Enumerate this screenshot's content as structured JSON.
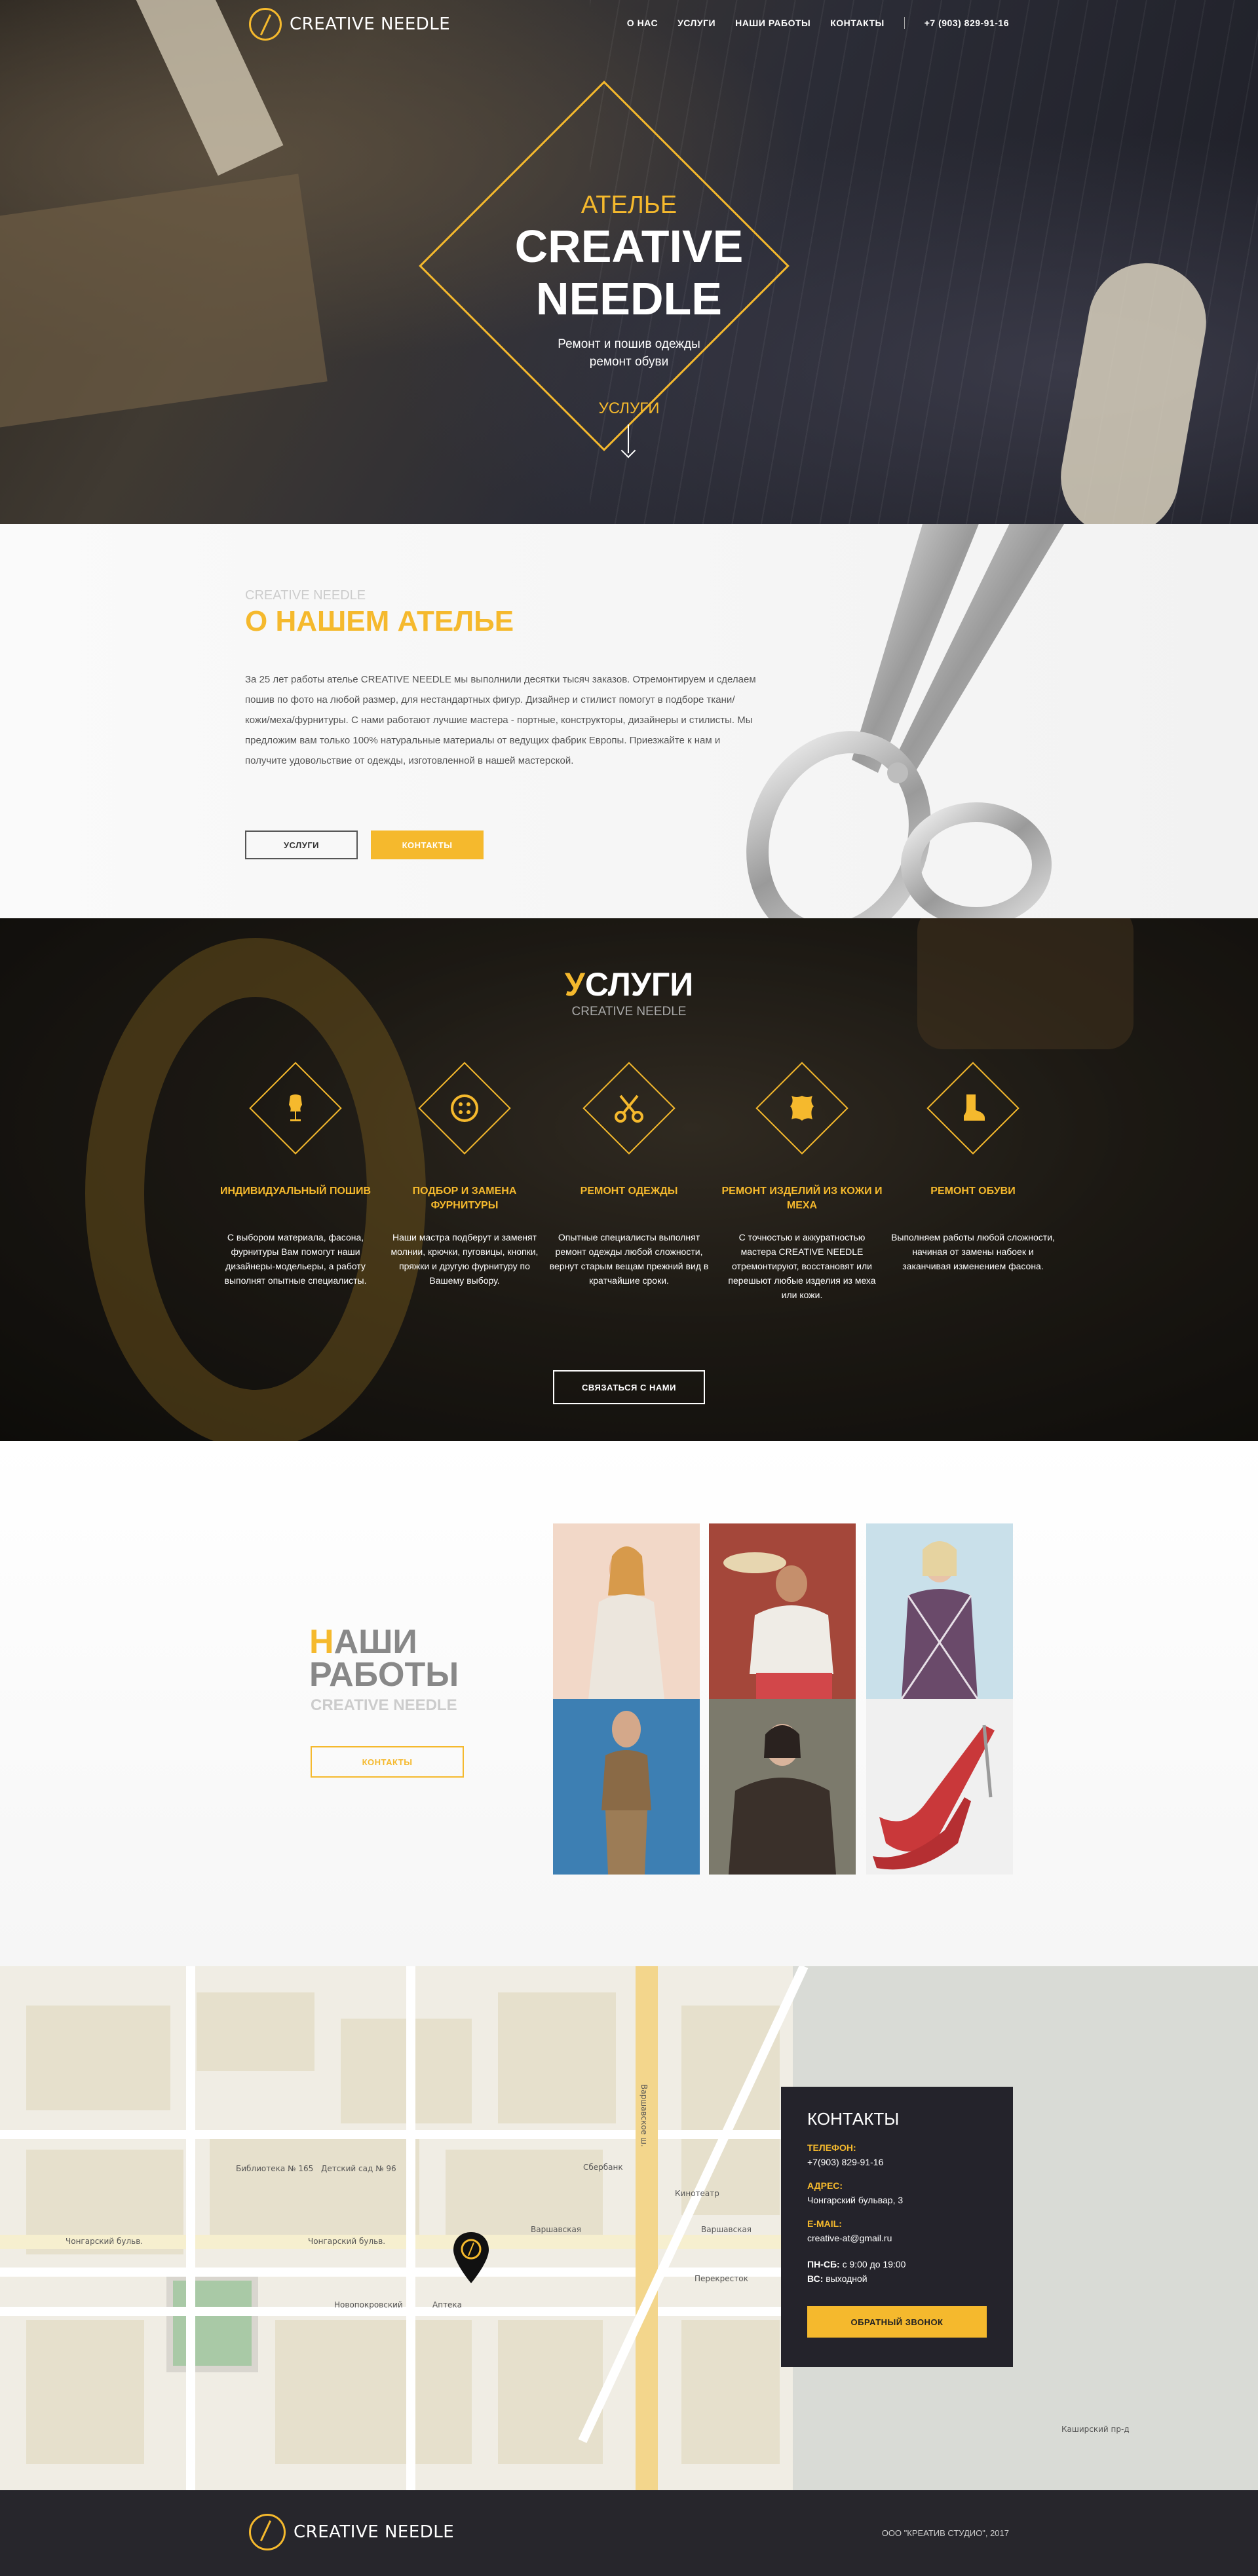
{
  "brand": {
    "name": "CREATIVE NEEDLE",
    "accent": "#f5b92d"
  },
  "nav": {
    "items": [
      "О НАС",
      "УСЛУГИ",
      "НАШИ РАБОТЫ",
      "КОНТАКТЫ"
    ],
    "phone": "+7 (903) 829-91-16"
  },
  "hero": {
    "kicker": "АТЕЛЬЕ",
    "title_line1": "CREATIVE",
    "title_line2": "NEEDLE",
    "subtitle_line1": "Ремонт и пошив одежды",
    "subtitle_line2": "ремонт обуви",
    "cta": "УСЛУГИ"
  },
  "about": {
    "sub": "CREATIVE NEEDLE",
    "title": "О НАШЕМ АТЕЛЬЕ",
    "text": "За 25 лет работы ателье CREATIVE NEEDLE мы выполнили десятки тысяч заказов. Отремонтируем и сделаем пошив по фото на любой размер, для нестандартных фигур. Дизайнер и стилист помогут в подборе ткани/кожи/меха/фурнитуры. С нами работают лучшие мастера - портные, конструкторы, дизайнеры и стилисты. Мы предложим вам только 100% натуральные материалы от ведущих фабрик Европы. Приезжайте к нам и получите удовольствие от одежды, изготовленной в нашей мастерской.",
    "btn_services": "УСЛУГИ",
    "btn_contacts": "КОНТАКТЫ"
  },
  "services": {
    "title_first": "У",
    "title_rest": "СЛУГИ",
    "sub": "CREATIVE NEEDLE",
    "items": [
      {
        "icon": "mannequin-icon",
        "title": "ИНДИВИДУАЛЬНЫЙ ПОШИВ",
        "desc": "С выбором материала, фасона, фурнитуры Вам помогут наши дизайнеры-модельеры, а работу выполнят опытные специалисты."
      },
      {
        "icon": "button-icon",
        "title": "ПОДБОР И ЗАМЕНА ФУРНИТУРЫ",
        "desc": "Наши мастра подберут и заменят молнии, крючки, пуговицы, кнопки, пряжки и другую фурнитуру по Вашему выбору."
      },
      {
        "icon": "scissors-icon",
        "title": "РЕМОНТ ОДЕЖДЫ",
        "desc": "Опытные специалисты выполнят ремонт одежды любой сложности, вернут старым вещам прежний вид в кратчайшие сроки."
      },
      {
        "icon": "leather-icon",
        "title": "РЕМОНТ ИЗДЕЛИЙ ИЗ КОЖИ И МЕХА",
        "desc": "С точностью и аккуратностью мастера CREATIVE NEEDLE отремонтируют, восстановят или перешьют любые изделия из меха или кожи."
      },
      {
        "icon": "boot-icon",
        "title": "РЕМОНТ ОБУВИ",
        "desc": "Выполняем работы любой сложности, начиная от замены набоек и заканчивая изменением фасона."
      }
    ],
    "cta": "СВЯЗАТЬСЯ С НАМИ"
  },
  "works": {
    "title_first": "Н",
    "title_line1_rest": "АШИ",
    "title_line2": "РАБОТЫ",
    "sub": "CREATIVE NEEDLE",
    "btn": "КОНТАКТЫ",
    "photos": [
      {
        "name": "work-photo-white-dress",
        "bg": "#f2d8c8",
        "fg": "#ece6dd"
      },
      {
        "name": "work-photo-man-hat",
        "bg": "#a4473a",
        "fg": "#efece6"
      },
      {
        "name": "work-photo-checked-coat",
        "bg": "#c9e0ea",
        "fg": "#6a4a6a"
      },
      {
        "name": "work-photo-khaki-suit",
        "bg": "#3d7fb3",
        "fg": "#8a6a46"
      },
      {
        "name": "work-photo-fur-coat",
        "bg": "#7c7a6c",
        "fg": "#3a302a"
      },
      {
        "name": "work-photo-red-shoes",
        "bg": "#f0f0f0",
        "fg": "#c9383a"
      }
    ]
  },
  "map": {
    "labels": [
      "Чонгарский бульв.",
      "Чонгарский бульв.",
      "Варшавское ш.",
      "Варшавская",
      "Варшавская",
      "Сбербанк",
      "Кинотеатр",
      "Библиотека № 165",
      "Детский сад № 96",
      "Новопокровский",
      "Аптека",
      "Перекресток",
      "Каширский пр-д"
    ]
  },
  "contacts": {
    "title": "КОНТАКТЫ",
    "phone_label": "ТЕЛЕФОН:",
    "phone": "+7(903) 829-91-16",
    "address_label": "АДРЕС:",
    "address": "Чонгарский бульвар, 3",
    "email_label": "E-MAIL:",
    "email": "creative-at@gmail.ru",
    "hours_label": "ПН-СБ:",
    "hours": "с 9:00 до 19:00",
    "sunday_label": "ВС:",
    "sunday": "выходной",
    "btn": "ОБРАТНЫЙ ЗВОНОК"
  },
  "footer": {
    "brand": "CREATIVE NEEDLE",
    "copyright": "ООО \"КРЕАТИВ СТУДИО\", 2017"
  }
}
